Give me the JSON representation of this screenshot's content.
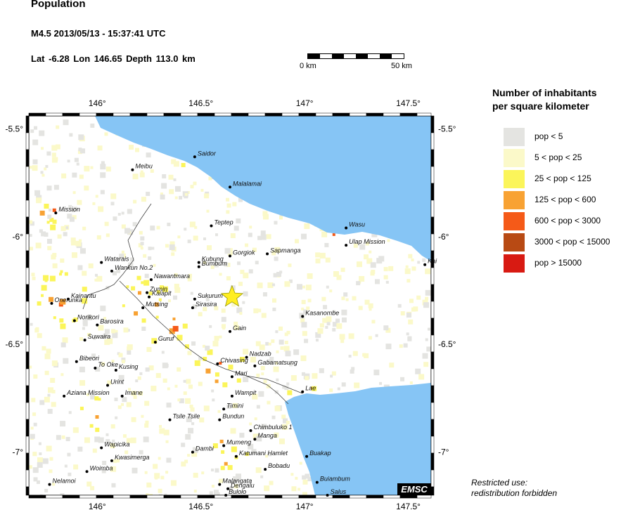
{
  "header": {
    "title": "Population",
    "event": "M4.5  2013/05/13 - 15:37:41 UTC",
    "location": "Lat -6.28    Lon 146.65     Depth 113.0 km"
  },
  "scale_bar": {
    "left_label": "0 km",
    "right_label": "50 km"
  },
  "map": {
    "lon_range": [
      145.67,
      147.61
    ],
    "lat_range": [
      -7.2,
      -5.44
    ],
    "x_ticks": [
      {
        "value": 146.0,
        "label": "146°"
      },
      {
        "value": 146.5,
        "label": "146.5°"
      },
      {
        "value": 147.0,
        "label": "147°"
      },
      {
        "value": 147.5,
        "label": "147.5°"
      }
    ],
    "y_ticks": [
      {
        "value": -5.5,
        "label": "-5.5°"
      },
      {
        "value": -6.0,
        "label": "-6°"
      },
      {
        "value": -6.5,
        "label": "-6.5°"
      },
      {
        "value": -7.0,
        "label": "-7°"
      }
    ],
    "epicenter": {
      "lon": 146.65,
      "lat": -6.28
    },
    "watermark": "EMSC",
    "places": [
      {
        "name": "Saidor",
        "lon": 146.47,
        "lat": -5.63
      },
      {
        "name": "Meibu",
        "lon": 146.17,
        "lat": -5.69
      },
      {
        "name": "Malalamai",
        "lon": 146.64,
        "lat": -5.77
      },
      {
        "name": "Mission",
        "lon": 145.8,
        "lat": -5.89
      },
      {
        "name": "Teptep",
        "lon": 146.55,
        "lat": -5.95
      },
      {
        "name": "Wasu",
        "lon": 147.2,
        "lat": -5.96
      },
      {
        "name": "Ulap Mission",
        "lon": 147.2,
        "lat": -6.04
      },
      {
        "name": "Sapmanga",
        "lon": 146.82,
        "lat": -6.08
      },
      {
        "name": "Gorgiok",
        "lon": 146.64,
        "lat": -6.09
      },
      {
        "name": "Kubung",
        "lon": 146.49,
        "lat": -6.12
      },
      {
        "name": "Bumbum",
        "lon": 146.49,
        "lat": -6.14
      },
      {
        "name": "Watarais",
        "lon": 146.02,
        "lat": -6.12
      },
      {
        "name": "Wankun No.2",
        "lon": 146.07,
        "lat": -6.16
      },
      {
        "name": "Nawantmara",
        "lon": 146.26,
        "lat": -6.2
      },
      {
        "name": "Kai",
        "lon": 147.58,
        "lat": -6.13
      },
      {
        "name": "Zumin",
        "lon": 146.24,
        "lat": -6.26
      },
      {
        "name": "Kaiapit",
        "lon": 146.25,
        "lat": -6.28
      },
      {
        "name": "Sukurum",
        "lon": 146.47,
        "lat": -6.29
      },
      {
        "name": "Sirasira",
        "lon": 146.46,
        "lat": -6.33
      },
      {
        "name": "Kainantu",
        "lon": 145.86,
        "lat": -6.29
      },
      {
        "name": "Onerunka",
        "lon": 145.78,
        "lat": -6.31
      },
      {
        "name": "Mutsing",
        "lon": 146.22,
        "lat": -6.33
      },
      {
        "name": "Kasanombe",
        "lon": 146.99,
        "lat": -6.37
      },
      {
        "name": "Norikori",
        "lon": 145.89,
        "lat": -6.39
      },
      {
        "name": "Barosira",
        "lon": 146.0,
        "lat": -6.41
      },
      {
        "name": "Gain",
        "lon": 146.64,
        "lat": -6.44
      },
      {
        "name": "Suwaira",
        "lon": 145.94,
        "lat": -6.48
      },
      {
        "name": "Guruf",
        "lon": 146.28,
        "lat": -6.49
      },
      {
        "name": "Nadzab",
        "lon": 146.72,
        "lat": -6.56
      },
      {
        "name": "Bibeori",
        "lon": 145.9,
        "lat": -6.58
      },
      {
        "name": "Chivasing",
        "lon": 146.58,
        "lat": -6.59
      },
      {
        "name": "Gabamatsung",
        "lon": 146.76,
        "lat": -6.6
      },
      {
        "name": "To Oke",
        "lon": 145.99,
        "lat": -6.61
      },
      {
        "name": "Kusing",
        "lon": 146.09,
        "lat": -6.62
      },
      {
        "name": "Mari",
        "lon": 146.65,
        "lat": -6.65
      },
      {
        "name": "Urint",
        "lon": 146.05,
        "lat": -6.69
      },
      {
        "name": "Lae",
        "lon": 146.99,
        "lat": -6.72
      },
      {
        "name": "Wampit",
        "lon": 146.65,
        "lat": -6.74
      },
      {
        "name": "Aziana Mission",
        "lon": 145.84,
        "lat": -6.74
      },
      {
        "name": "Imane",
        "lon": 146.12,
        "lat": -6.74
      },
      {
        "name": "Timini",
        "lon": 146.61,
        "lat": -6.8
      },
      {
        "name": "Tsile Tsile",
        "lon": 146.35,
        "lat": -6.85
      },
      {
        "name": "Bundun",
        "lon": 146.59,
        "lat": -6.85
      },
      {
        "name": "Chimbuluko 1",
        "lon": 146.74,
        "lat": -6.9
      },
      {
        "name": "Manga",
        "lon": 146.76,
        "lat": -6.94
      },
      {
        "name": "Mumeng",
        "lon": 146.61,
        "lat": -6.97
      },
      {
        "name": "Wapicika",
        "lon": 146.02,
        "lat": -6.98
      },
      {
        "name": "Dambi",
        "lon": 146.46,
        "lat": -7.0
      },
      {
        "name": "Katumani Hamlet",
        "lon": 146.67,
        "lat": -7.02
      },
      {
        "name": "Buakap",
        "lon": 147.01,
        "lat": -7.02
      },
      {
        "name": "Kwasimerga",
        "lon": 146.07,
        "lat": -7.04
      },
      {
        "name": "Woimba",
        "lon": 145.95,
        "lat": -7.09
      },
      {
        "name": "Bobadu",
        "lon": 146.81,
        "lat": -7.08
      },
      {
        "name": "Nelamoi",
        "lon": 145.77,
        "lat": -7.15
      },
      {
        "name": "Buiambum",
        "lon": 147.06,
        "lat": -7.14
      },
      {
        "name": "Malangata",
        "lon": 146.59,
        "lat": -7.15
      },
      {
        "name": "Dengalu",
        "lon": 146.63,
        "lat": -7.17
      },
      {
        "name": "Bulolo",
        "lon": 146.62,
        "lat": -7.2
      },
      {
        "name": "Salus",
        "lon": 147.11,
        "lat": -7.2
      }
    ]
  },
  "legend": {
    "title_line1": "Number of inhabitants",
    "title_line2": "per square kilometer",
    "items": [
      {
        "label": "pop < 5",
        "color": "#e4e4e1"
      },
      {
        "label": "5 < pop < 25",
        "color": "#fbf9c9"
      },
      {
        "label": "25 < pop < 125",
        "color": "#fbf55a"
      },
      {
        "label": "125 < pop < 600",
        "color": "#f8a233"
      },
      {
        "label": "600 < pop < 3000",
        "color": "#f55a18"
      },
      {
        "label": "3000 < pop < 15000",
        "color": "#b84a14"
      },
      {
        "label": "pop > 15000",
        "color": "#d81a12"
      }
    ]
  },
  "colors": {
    "sea": "#86c5f5",
    "land": "#ffffff",
    "epicenter": "#ffee22"
  },
  "restricted": {
    "line1": "Restricted use:",
    "line2": "redistribution forbidden"
  }
}
